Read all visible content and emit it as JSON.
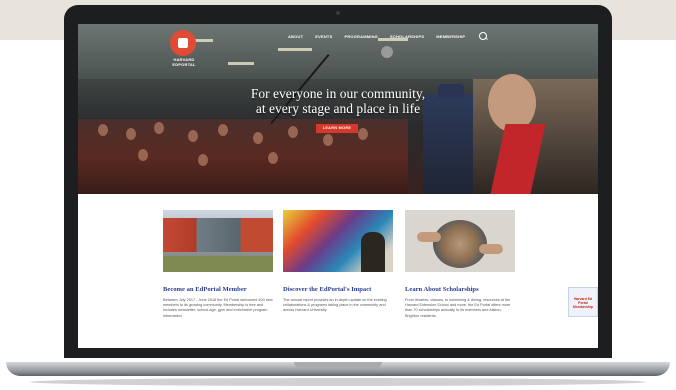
{
  "site": {
    "logo_text": "HARVARD EDPORTAL"
  },
  "nav": {
    "items": [
      "ABOUT",
      "EVENTS",
      "PROGRAMMING",
      "SCHOLARSHIPS",
      "MEMBERSHIP"
    ]
  },
  "hero": {
    "headline_line1": "For everyone in our community,",
    "headline_line2": "at every stage and place in life",
    "cta_label": "LEARN MORE"
  },
  "cards": [
    {
      "title": "Become an EdPortal Member",
      "body": "Between July 2017 - June 2018 the Ed Portal welcomed 400 new members to its growing community. Membership is free and includes newsletter, school-age, gym and enrichment program information."
    },
    {
      "title": "Discover the EdPortal's Impact",
      "body": "The annual report provides an in-depth update on the exciting collaborations & programs taking place in the community and across Harvard University."
    },
    {
      "title": "Learn About Scholarships",
      "body": "From libraries, classes, to swimming & dining, resources at the Harvard Extension School and more, the Ed Portal offers more than 70 scholarships annually to its members and Allston-Brighton residents."
    }
  ],
  "badge": {
    "label": "Harvard Ed Portal Membership"
  },
  "colors": {
    "accent": "#d4392c",
    "link_blue": "#2a3d8f"
  }
}
